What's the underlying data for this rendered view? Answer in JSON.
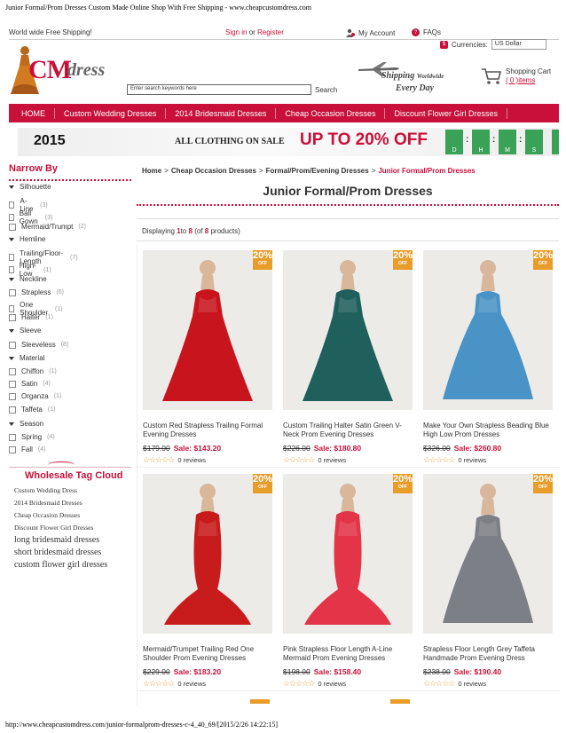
{
  "print_header": "Junior Formal/Prom Dresses Custom Made Online Shop With Free Shipping - www.cheapcustomdress.com",
  "print_footer": "http://www.cheapcustomdress.com/junior-formalprom-dresses-c-4_40_69/[2015/2/26 14:22:15]",
  "topbar": {
    "free_shipping": "World wide Free Shipping!",
    "sign_in": "Sign in",
    "or": "or",
    "register": "Register",
    "my_account": "My Account",
    "faqs": "FAQs",
    "currencies_label": "Currencies:",
    "currency_value": "US Dollar"
  },
  "logo": {
    "cm": "CM",
    "dress": "dress"
  },
  "search": {
    "placeholder": "Enter search keywords here",
    "button": "Search"
  },
  "shipping_promo": {
    "line1": "Shipping",
    "line1_small": "Worldwide",
    "line2": "Every Day"
  },
  "cart": {
    "title": "Shopping Cart",
    "items": "( 0 )items"
  },
  "nav": [
    "HOME",
    "Custom Wedding Dresses",
    "2014 Bridesmaid Dresses",
    "Cheap Occasion Dresses",
    "Discount Flower Girl Dresses"
  ],
  "banner": {
    "year": "2015",
    "all_clothing": "ALL CLOTHING ON SALE",
    "up_to": "UP TO 20% OFF",
    "timer_labels": [
      "D",
      "H",
      "M",
      "S"
    ]
  },
  "sidebar": {
    "title": "Narrow By",
    "facets": [
      {
        "name": "Silhouette",
        "options": [
          {
            "label": "A-Line",
            "count": "(3)"
          },
          {
            "label": "Ball Gown",
            "count": "(3)"
          },
          {
            "label": "Mermaid/Trumpt",
            "count": "(2)"
          }
        ]
      },
      {
        "name": "Hemline",
        "options": [
          {
            "label": "Trailing/Floor-Length",
            "count": "(7)"
          },
          {
            "label": "High-Low",
            "count": "(1)"
          }
        ]
      },
      {
        "name": "Neckline",
        "options": [
          {
            "label": "Strapless",
            "count": "(6)"
          },
          {
            "label": "One Shoulder",
            "count": "(1)"
          },
          {
            "label": "Halter",
            "count": "(1)"
          }
        ]
      },
      {
        "name": "Sleeve",
        "options": [
          {
            "label": "Sleeveless",
            "count": "(8)"
          }
        ]
      },
      {
        "name": "Material",
        "options": [
          {
            "label": "Chiffon",
            "count": "(1)"
          },
          {
            "label": "Satin",
            "count": "(4)"
          },
          {
            "label": "Organza",
            "count": "(1)"
          },
          {
            "label": "Taffeta",
            "count": "(1)"
          }
        ]
      },
      {
        "name": "Season",
        "options": [
          {
            "label": "Spring",
            "count": "(4)"
          },
          {
            "label": "Fall",
            "count": "(4)"
          }
        ]
      }
    ]
  },
  "tag_cloud": {
    "title": "Wholesale Tag Cloud",
    "links": [
      "Custom Wedding Dress",
      "2014 Bridesmaid Dresses",
      "Cheap Occasion Dresses",
      "Discount Flower Girl Dresses"
    ],
    "big_links": [
      "long bridesmaid dresses",
      "short bridesmaid dresses",
      "custom flower girl dresses"
    ]
  },
  "breadcrumb": {
    "home": "Home",
    "sep": ">",
    "l1": "Cheap Occasion Dresses",
    "l2": "Formal/Prom/Evening Dresses",
    "current": "Junior Formal/Prom Dresses"
  },
  "page_title": "Junior Formal/Prom Dresses",
  "displaying": {
    "prefix": "Displaying",
    "from": "1",
    "to_word": "to",
    "to": "8",
    "of": "(of",
    "total": "8",
    "suffix": "products)"
  },
  "off_badge": {
    "percent": "20%",
    "off": "OFF"
  },
  "products": [
    {
      "name": "Custom Red Strapless Trailing Formal Evening Dresses",
      "old_price": "$179.00",
      "sale": "Sale: $143.20",
      "reviews": "0 reviews",
      "color": "#c8141c"
    },
    {
      "name": "Custom Trailing Halter Satin Green V-Neck Prom Evening Dresses",
      "old_price": "$226.00",
      "sale": "Sale: $180.80",
      "reviews": "0 reviews",
      "color": "#1f5f5c"
    },
    {
      "name": "Make Your Own Strapless Beading Blue High Low Prom Dresses",
      "old_price": "$326.00",
      "sale": "Sale: $260.80",
      "reviews": "0 reviews",
      "color": "#4a93c6"
    },
    {
      "name": "Mermaid/Trumpet Trailing Red One Shoulder Prom Evening Dresses",
      "old_price": "$229.00",
      "sale": "Sale: $183.20",
      "reviews": "0 reviews",
      "color": "#c81b1b"
    },
    {
      "name": "Pink Strapless Floor Length A-Line Mermaid Prom Evening Dresses",
      "old_price": "$198.00",
      "sale": "Sale: $158.40",
      "reviews": "0 reviews",
      "color": "#e33448"
    },
    {
      "name": "Strapless Floor Length Grey Taffeta Handmade Prom Evening Dress",
      "old_price": "$238.00",
      "sale": "Sale: $190.40",
      "reviews": "0 reviews",
      "color": "#7d7f86"
    }
  ],
  "colors": {
    "accent": "#c8103a",
    "badge": "#e89c2a",
    "star": "#e8a33a",
    "timer": "#3aa257"
  }
}
